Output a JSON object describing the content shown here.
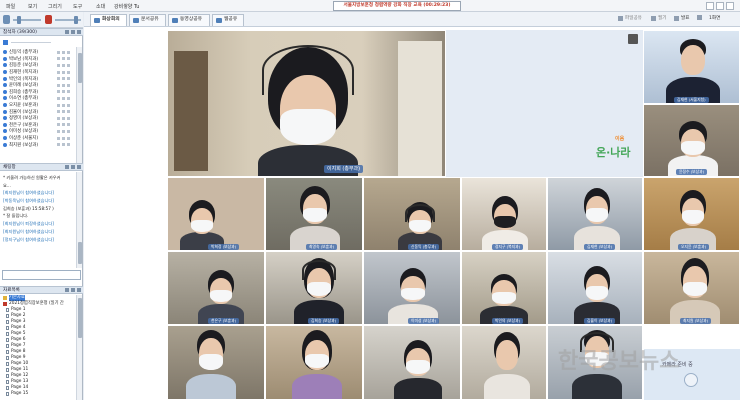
{
  "menubar": {
    "items": [
      "파일",
      "보기",
      "그리기",
      "도구",
      "소대",
      "강비쌓양 Tu"
    ],
    "title": "서울지방보훈청 청렴역량 강화 직장 교육 (00:29:23)"
  },
  "left": {
    "participants_header": "참석자 (39/300)",
    "participants": [
      "신동익 (총무과)",
      "박보남 (복지과)",
      "김동준 (보상과)",
      "김재현 (복지과)",
      "박인의 (복지과)",
      "윤미례 (보상과)",
      "김희승 (총무과)",
      "이소연 (총무과)",
      "오지윤 (보훈과)",
      "김율이 (보상과)",
      "정영미 (보상과)",
      "천은구 (보훈과)",
      "이미성 (보상과)",
      "이상춘 (서울지)",
      "최지원 (보상과)"
    ],
    "chat_header": "채팅창",
    "chat_lines": [
      {
        "text": "* 키울려 가능하신 원활은 카우커",
        "sys": false
      },
      {
        "text": "요...",
        "sys": false
      },
      {
        "text": "[최지원님이 참여하셨습니다]",
        "sys": true
      },
      {
        "text": "[박동욱님이 참여하셨습니다]",
        "sys": true
      },
      {
        "text": "김희승 (보훈과) 15:58:57 )",
        "sys": false
      },
      {
        "text": "* 잘 들립니다.",
        "sys": false
      },
      {
        "text": "[최지원님이 퇴장하셨습니다]",
        "sys": true
      },
      {
        "text": "[최지원님이 참여하셨습니다]",
        "sys": true
      },
      {
        "text": "[정지구님이 참여하셨습니다]",
        "sys": true
      }
    ],
    "docs_header": "자료목록",
    "doc_root": "기본자료",
    "doc_file": "2021청렴직장보훈청 (일기 간",
    "pages": [
      "Page 1",
      "Page 2",
      "Page 3",
      "Page 4",
      "Page 5",
      "Page 6",
      "Page 7",
      "Page 8",
      "Page 9",
      "Page 10",
      "Page 11",
      "Page 12",
      "Page 13",
      "Page 14",
      "Page 15"
    ]
  },
  "tabs": [
    "화상회의",
    "문서공유",
    "동영상공유",
    "웹공유"
  ],
  "toolbar": {
    "items": [
      "파일공유",
      "필기",
      "발표",
      "1화면"
    ]
  },
  "stage": {
    "logo": "온·나라",
    "logo_sub": "이음",
    "speaker_name": "이지희 (총무과)",
    "presenter_name": "김재현 (서울지청)",
    "tile_names": [
      "윤정수 (보상과)",
      "박희정 (보상과)",
      "최영숙 (보훈과)",
      "신동익 (총무과)",
      "정지구 (복지과)",
      "김재현 (보상과)",
      "오지윤 (보훈과)",
      "천은구 (보훈과)",
      "김희승 (보상과)",
      "이미성 (보상과)",
      "박인의 (보상과)",
      "김율이 (보상과)",
      "최지원 (보상과)",
      "이상춘 (서울지)",
      "박보남 (복지과)",
      "이소연 (총무과)"
    ],
    "waiting_label": "카메라 준비 중",
    "watermark": "한국공보뉴스"
  }
}
